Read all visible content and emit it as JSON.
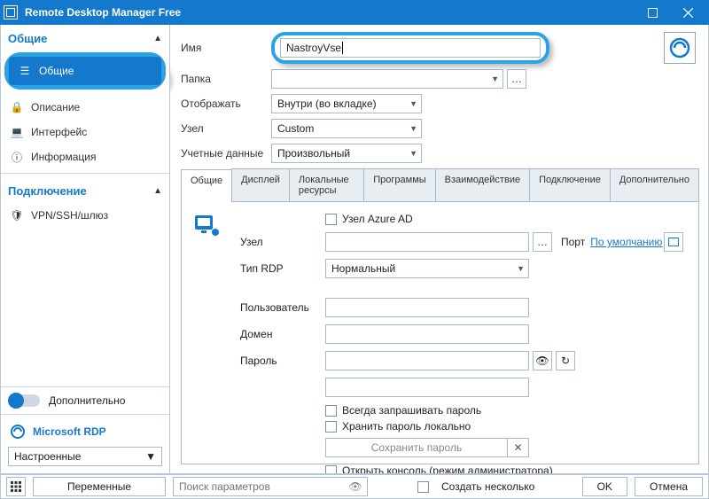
{
  "window": {
    "title": "Remote Desktop Manager Free"
  },
  "sidebar": {
    "section_general": "Общие",
    "items": [
      {
        "icon": "hamburger-icon",
        "label": "Общие"
      },
      {
        "icon": "lock-icon",
        "label": "Описание"
      },
      {
        "icon": "screen-icon",
        "label": "Интерфейс"
      },
      {
        "icon": "info-icon",
        "label": "Информация"
      }
    ],
    "section_connection": "Подключение",
    "conn_items": [
      {
        "icon": "shield-icon",
        "label": "VPN/SSH/шлюз"
      }
    ],
    "advanced_label": "Дополнительно",
    "protocol": {
      "name": "Microsoft RDP",
      "mode": "Настроенные"
    }
  },
  "form": {
    "name_label": "Имя",
    "name_value": "NastroyVse",
    "folder_label": "Папка",
    "folder_value": "",
    "display_label": "Отображать",
    "display_value": "Внутри (во вкладке)",
    "host_label": "Узел",
    "host_value": "Custom",
    "cred_label": "Учетные данные",
    "cred_value": "Произвольный"
  },
  "tabs": [
    "Общие",
    "Дисплей",
    "Локальные ресурсы",
    "Программы",
    "Взаимодействие",
    "Подключение",
    "Дополнительно"
  ],
  "tabbody": {
    "azure_label": "Узел Azure AD",
    "host_label": "Узел",
    "host_value": "",
    "port_label": "Порт",
    "port_link": "По умолчанию",
    "rdptype_label": "Тип RDP",
    "rdptype_value": "Нормальный",
    "user_label": "Пользователь",
    "user_value": "",
    "domain_label": "Домен",
    "domain_value": "",
    "password_label": "Пароль",
    "password_value": "",
    "always_ask": "Всегда запрашивать пароль",
    "store_local": "Хранить пароль локально",
    "save_pw_btn": "Сохранить пароль",
    "open_console": "Открыть консоль (режим администратора)"
  },
  "bottom": {
    "variables": "Переменные",
    "search_placeholder": "Поиск параметров",
    "create_multiple": "Создать несколько",
    "ok": "OK",
    "cancel": "Отмена"
  }
}
